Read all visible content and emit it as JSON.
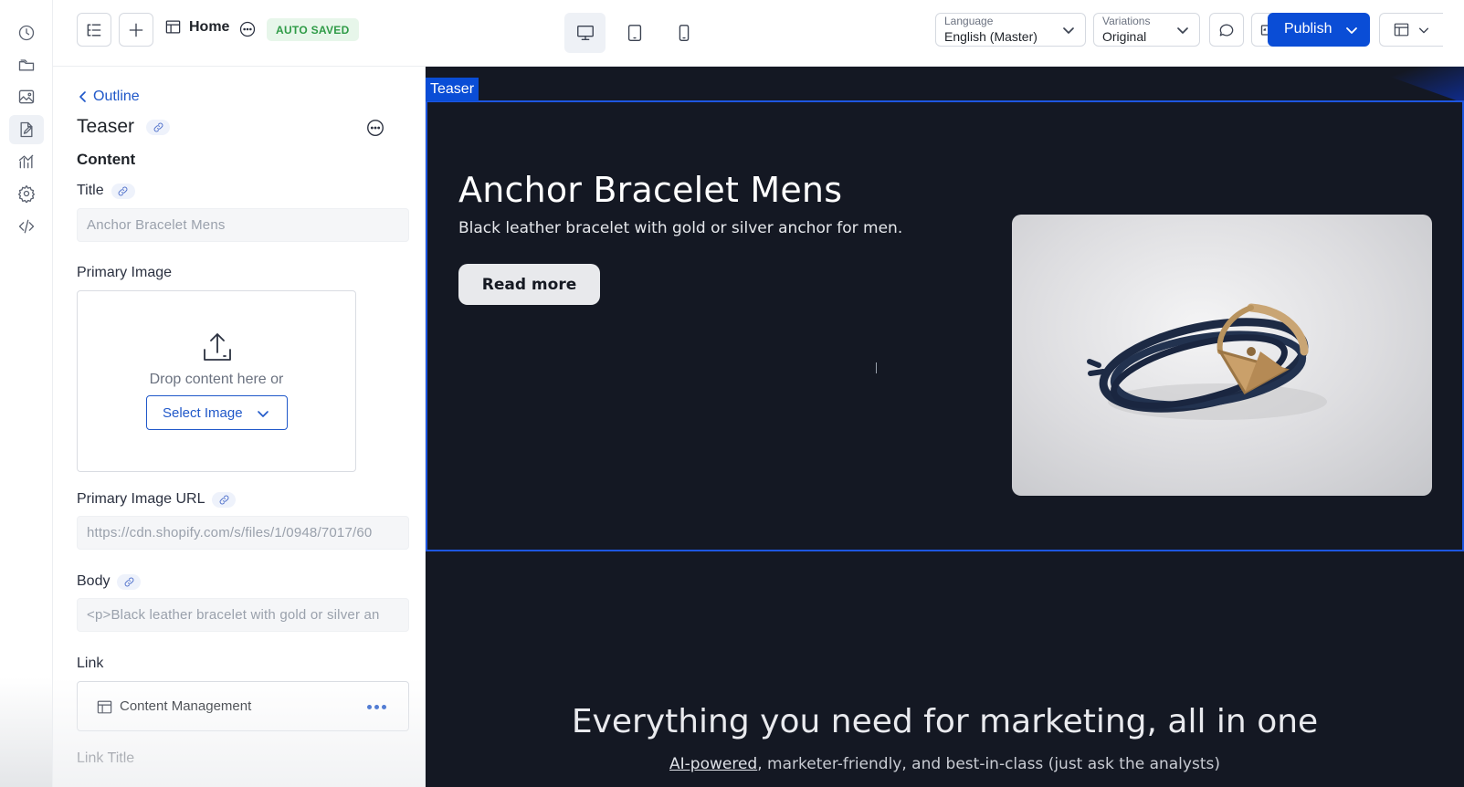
{
  "rail": {
    "items": [
      {
        "icon": "history-icon"
      },
      {
        "icon": "folders-icon"
      },
      {
        "icon": "image-icon"
      },
      {
        "icon": "edit-page-icon",
        "active": true
      },
      {
        "icon": "analytics-icon"
      },
      {
        "icon": "settings-icon"
      },
      {
        "icon": "code-icon"
      }
    ]
  },
  "topbar": {
    "page_name": "Home",
    "status_badge": "AUTO SAVED",
    "language": {
      "caption": "Language",
      "value": "English (Master)"
    },
    "variations": {
      "caption": "Variations",
      "value": "Original"
    },
    "publish_label": "Publish",
    "devices": [
      "desktop-icon",
      "tablet-icon",
      "mobile-icon"
    ],
    "active_device": "desktop"
  },
  "panel": {
    "back_label": "Outline",
    "component_title": "Teaser",
    "section_title": "Content",
    "fields": {
      "title": {
        "label": "Title",
        "value": "Anchor Bracelet Mens"
      },
      "primary_image": {
        "label": "Primary Image",
        "drop_text": "Drop content here or",
        "select_label": "Select Image"
      },
      "primary_image_url": {
        "label": "Primary Image URL",
        "value": "https://cdn.shopify.com/s/files/1/0948/7017/60"
      },
      "body": {
        "label": "Body",
        "value": "<p>Black leather bracelet with gold or silver an"
      },
      "link": {
        "label": "Link",
        "value": "Content Management"
      },
      "link_title": {
        "label": "Link Title"
      }
    }
  },
  "canvas": {
    "selected_tag": "Teaser",
    "hero": {
      "title": "Anchor Bracelet Mens",
      "body": "Black leather bracelet with gold or silver anchor for men.",
      "cta": "Read more"
    },
    "section": {
      "heading": "Everything you need for marketing, all in one",
      "sub_link": "AI-powered",
      "sub_rest": ", marketer-friendly, and best-in-class (just ask the analysts)"
    }
  },
  "colors": {
    "accent": "#0a4dd6",
    "canvas_bg": "#141823",
    "badge_bg": "#e7f6ea",
    "badge_text": "#2f9b47"
  }
}
